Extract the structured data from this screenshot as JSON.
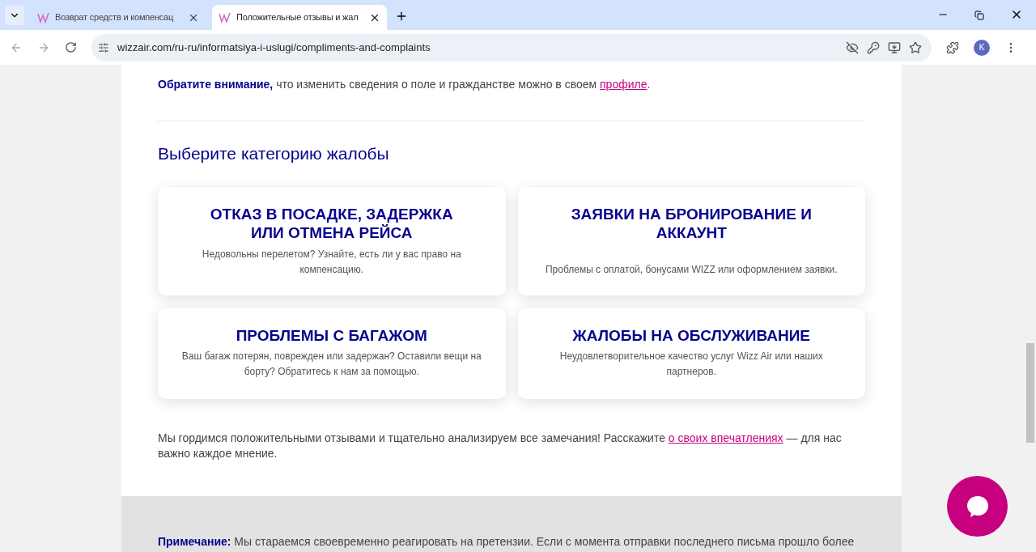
{
  "browser": {
    "tabs": [
      {
        "title": "Возврат средств и компенсац",
        "selected": false
      },
      {
        "title": "Положительные отзывы и жал",
        "selected": true
      }
    ],
    "address": "wizzair.com/ru-ru/informatsiya-i-uslugi/compliments-and-complaints",
    "profile_initial": "K"
  },
  "notice": {
    "lead": "Обратите внимание,",
    "text": " что изменить сведения о поле и гражданстве можно в своем ",
    "link": "профиле",
    "end": "."
  },
  "heading": "Выберите категорию жалобы",
  "categories": [
    {
      "title": "ОТКАЗ В ПОСАДКЕ, ЗАДЕРЖКА ИЛИ ОТМЕНА РЕЙСА",
      "description": "Недовольны перелетом? Узнайте, есть ли у вас право на компенсацию."
    },
    {
      "title": "ЗАЯВКИ НА БРОНИРОВАНИЕ И АККАУНТ",
      "description": "Проблемы с оплатой, бонусами WIZZ или оформлением заявки."
    },
    {
      "title": "ПРОБЛЕМЫ С БАГАЖОМ",
      "description": "Ваш багаж потерян, поврежден или задержан? Оставили вещи на борту? Обратитесь к нам за помощью."
    },
    {
      "title": "ЖАЛОБЫ НА ОБСЛУЖИВАНИЕ",
      "description": "Неудовлетворительное качество услуг Wizz Air или наших партнеров."
    }
  ],
  "feedback": {
    "text": "Мы гордимся положительными отзывами и тщательно анализируем все замечания! Расскажите ",
    "link": "о своих впечатлениях",
    "end": " — для нас важно каждое мнение."
  },
  "note": {
    "lead": "Примечание:",
    "text": " Мы стараемся своевременно реагировать на претензии. Если с момента отправки последнего письма прошло более"
  }
}
